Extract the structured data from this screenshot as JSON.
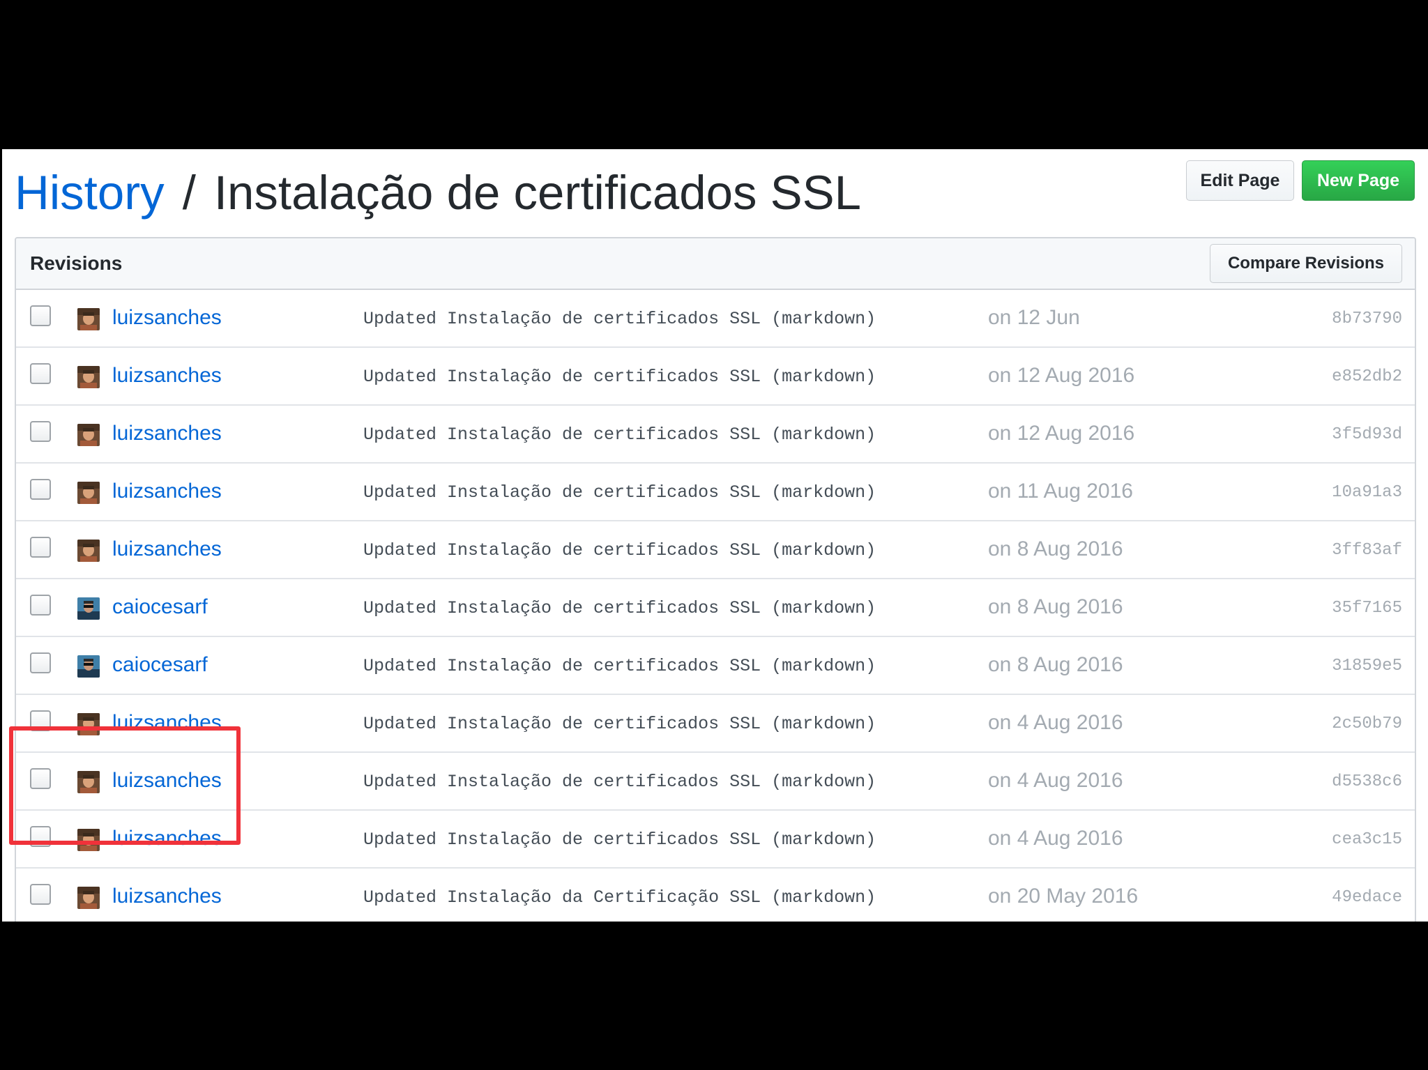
{
  "breadcrumb": {
    "history_label": "History",
    "separator": "/",
    "page_title": "Instalação de certificados SSL"
  },
  "actions": {
    "edit_label": "Edit Page",
    "new_label": "New Page"
  },
  "revisions": {
    "title": "Revisions",
    "compare_label": "Compare Revisions",
    "rows": [
      {
        "author": "luizsanches",
        "avatar": "avatar-luizsanches",
        "message": "Updated Instalação de certificados SSL (markdown)",
        "date": "on 12 Jun",
        "sha": "8b73790"
      },
      {
        "author": "luizsanches",
        "avatar": "avatar-luizsanches",
        "message": "Updated Instalação de certificados SSL (markdown)",
        "date": "on 12 Aug 2016",
        "sha": "e852db2"
      },
      {
        "author": "luizsanches",
        "avatar": "avatar-luizsanches",
        "message": "Updated Instalação de certificados SSL (markdown)",
        "date": "on 12 Aug 2016",
        "sha": "3f5d93d"
      },
      {
        "author": "luizsanches",
        "avatar": "avatar-luizsanches",
        "message": "Updated Instalação de certificados SSL (markdown)",
        "date": "on 11 Aug 2016",
        "sha": "10a91a3"
      },
      {
        "author": "luizsanches",
        "avatar": "avatar-luizsanches",
        "message": "Updated Instalação de certificados SSL (markdown)",
        "date": "on 8 Aug 2016",
        "sha": "3ff83af"
      },
      {
        "author": "caiocesarf",
        "avatar": "avatar-caiocesarf",
        "message": "Updated Instalação de certificados SSL (markdown)",
        "date": "on 8 Aug 2016",
        "sha": "35f7165"
      },
      {
        "author": "caiocesarf",
        "avatar": "avatar-caiocesarf",
        "message": "Updated Instalação de certificados SSL (markdown)",
        "date": "on 8 Aug 2016",
        "sha": "31859e5"
      },
      {
        "author": "luizsanches",
        "avatar": "avatar-luizsanches",
        "message": "Updated Instalação de certificados SSL (markdown)",
        "date": "on 4 Aug 2016",
        "sha": "2c50b79"
      },
      {
        "author": "luizsanches",
        "avatar": "avatar-luizsanches",
        "message": "Updated Instalação de certificados SSL (markdown)",
        "date": "on 4 Aug 2016",
        "sha": "d5538c6"
      },
      {
        "author": "luizsanches",
        "avatar": "avatar-luizsanches",
        "message": "Updated Instalação de certificados SSL (markdown)",
        "date": "on 4 Aug 2016",
        "sha": "cea3c15"
      },
      {
        "author": "luizsanches",
        "avatar": "avatar-luizsanches",
        "message": "Updated Instalação da Certificação SSL (markdown)",
        "date": "on 20 May 2016",
        "sha": "49edace"
      }
    ]
  },
  "colors": {
    "link": "#0366d6",
    "primary_button": "#28a745",
    "highlight": "#f0323a",
    "muted": "#a3aab1"
  }
}
